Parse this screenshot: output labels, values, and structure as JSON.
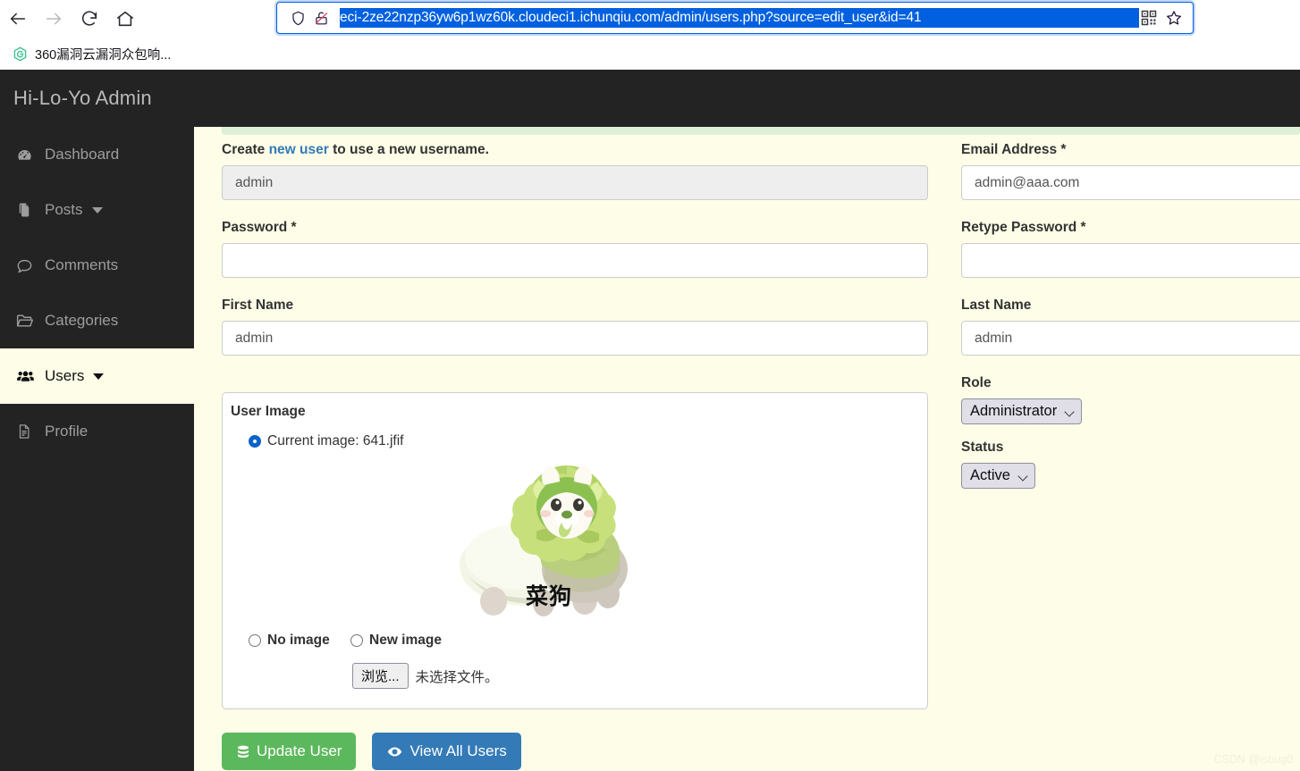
{
  "browser": {
    "nav": {
      "back": "back-arrow",
      "forward": "forward-arrow",
      "reload": "reload",
      "home": "home"
    },
    "url": "eci-2ze22nzp36yw6p1wz60k.cloudeci1.ichunqiu.com/admin/users.php?source=edit_user&id=41",
    "url_selected": true,
    "shield_icon": "shield-icon",
    "lock_broken_icon": "broken-lock-icon",
    "qr_icon": "qr-code-icon",
    "bookmark_star_icon": "star-icon",
    "bookmarks": [
      {
        "label": "360漏洞云漏洞众包响...",
        "icon": "360-logo-icon"
      }
    ]
  },
  "app": {
    "brand": "Hi-Lo-Yo Admin",
    "sidebar": {
      "items": [
        {
          "label": "Dashboard",
          "icon": "tachometer-icon",
          "caret": false,
          "active": false
        },
        {
          "label": "Posts",
          "icon": "copy-icon",
          "caret": true,
          "active": false
        },
        {
          "label": "Comments",
          "icon": "comment-icon",
          "caret": false,
          "active": false
        },
        {
          "label": "Categories",
          "icon": "folder-open-icon",
          "caret": false,
          "active": false
        },
        {
          "label": "Users",
          "icon": "users-icon",
          "caret": true,
          "active": true
        },
        {
          "label": "Profile",
          "icon": "file-icon",
          "caret": false,
          "active": false
        }
      ]
    },
    "form": {
      "username_note_prefix": "Create ",
      "username_note_link": "new user",
      "username_note_suffix": " to use a new username.",
      "username_value": "admin",
      "password_label": "Password *",
      "password_value": "",
      "first_name_label": "First Name",
      "first_name_value": "admin",
      "email_label": "Email Address *",
      "email_value": "admin@aaa.com",
      "retype_password_label": "Retype Password *",
      "retype_password_value": "",
      "last_name_label": "Last Name",
      "last_name_value": "admin",
      "user_image": {
        "title": "User Image",
        "current_option": "Current image: 641.jfif",
        "current_selected": true,
        "no_image_option": "No image",
        "no_image_selected": false,
        "new_image_option": "New image",
        "new_image_selected": false,
        "browse_button": "浏览...",
        "file_status": "未选择文件。",
        "image_caption": "菜狗"
      },
      "role_label": "Role",
      "role_value": "Administrator",
      "status_label": "Status",
      "status_value": "Active"
    },
    "buttons": {
      "update": "Update User",
      "update_icon": "database-icon",
      "view_all": "View All Users",
      "view_all_icon": "eye-icon"
    }
  },
  "watermark": "CSDN @isbug0",
  "colors": {
    "sidebar_bg": "#232323",
    "page_bg": "#fefee8",
    "accent_green": "#5cb85c",
    "accent_blue": "#337ab7",
    "link_blue": "#337ab7",
    "alert_green_bg": "#dff0d8"
  }
}
